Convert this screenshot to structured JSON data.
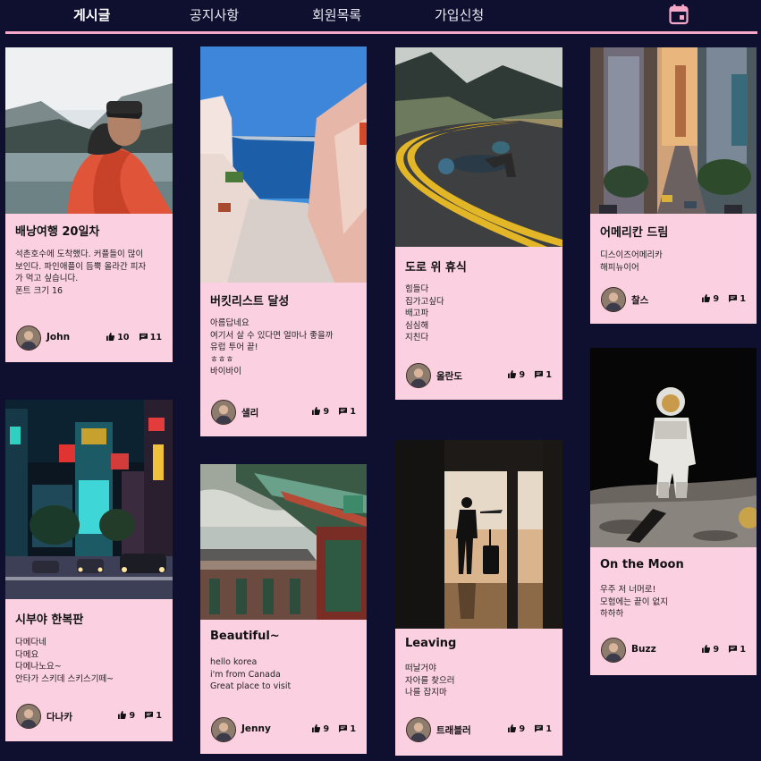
{
  "nav": {
    "items": [
      {
        "label": "게시글",
        "active": true
      },
      {
        "label": "공지사항"
      },
      {
        "label": "회원목록"
      },
      {
        "label": "가입신청"
      }
    ],
    "calendar_icon": "calendar-icon",
    "accent_color": "#f7a8c8",
    "background_color": "#0f1030",
    "card_color": "#fbd0e0"
  },
  "posts": [
    {
      "title": "배낭여행 20일차",
      "body": [
        "석촌호수에 도착했다. 커플들이 많이",
        "보인다. 파인애플이 듬뿍 올라간 피자",
        "가 먹고 싶습니다.",
        "폰트 크기 16"
      ],
      "author": "John",
      "likes": "10",
      "comments": "11"
    },
    {
      "title": "시부야 한복판",
      "body": [
        "다메다네",
        "다메요",
        "다메나노요~",
        "안타가 스키데 스키스기떼~"
      ],
      "author": "다나카",
      "likes": "9",
      "comments": "1"
    },
    {
      "title": "버킷리스트 달성",
      "body": [
        "아름답네요",
        "여기서 살 수 있다면 얼마나 좋을까",
        "유럽 투어 끝!",
        "ㅎㅎㅎ",
        "바이바이"
      ],
      "author": "샐리",
      "likes": "9",
      "comments": "1"
    },
    {
      "title": "Beautiful~",
      "body": [
        "hello korea",
        "i'm from Canada",
        "Great place to visit"
      ],
      "author": "Jenny",
      "likes": "9",
      "comments": "1"
    },
    {
      "title": "도로 위 휴식",
      "body": [
        "힘들다",
        "집가고싶다",
        "배고파",
        "심심해",
        "지친다"
      ],
      "author": "올란도",
      "likes": "9",
      "comments": "1"
    },
    {
      "title": "Leaving",
      "body": [
        "떠날거야",
        "자아를 찾으러",
        "나를 잡지마"
      ],
      "author": "트래블러",
      "likes": "9",
      "comments": "1"
    },
    {
      "title": "어메리칸 드림",
      "body": [
        "디스이즈어메리카",
        "해피뉴이어"
      ],
      "author": "찰스",
      "likes": "9",
      "comments": "1"
    },
    {
      "title": "On the Moon",
      "body": [
        "우주 저 너머로!",
        "모험에는 끝이 없지",
        "하하하"
      ],
      "author": "Buzz",
      "likes": "9",
      "comments": "1"
    }
  ]
}
